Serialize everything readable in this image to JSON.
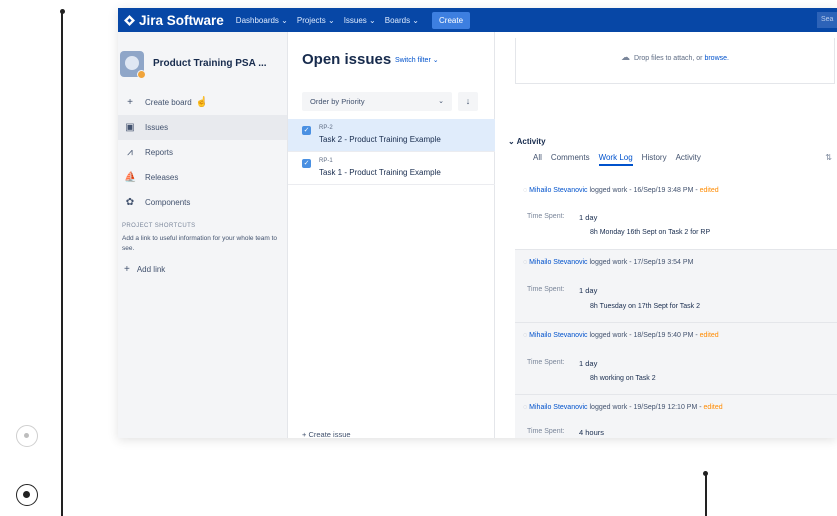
{
  "app": {
    "name": "Jira Software",
    "nav": [
      "Dashboards ⌄",
      "Projects ⌄",
      "Issues ⌄",
      "Boards ⌄"
    ],
    "create_label": "Create",
    "search_stub": "Sea"
  },
  "sidebar": {
    "project_name": "Product Training PSA ...",
    "create_board": "Create board",
    "items": [
      {
        "label": "Issues",
        "icon": "issues-icon"
      },
      {
        "label": "Reports",
        "icon": "reports-icon"
      },
      {
        "label": "Releases",
        "icon": "releases-icon"
      },
      {
        "label": "Components",
        "icon": "components-icon"
      }
    ],
    "shortcuts_title": "PROJECT SHORTCUTS",
    "shortcuts_note": "Add a link to useful information for your whole team to see.",
    "add_link": "Add link"
  },
  "issues_panel": {
    "title": "Open issues",
    "switch_filter": "Switch filter ⌄",
    "order_by": "Order by Priority",
    "issues": [
      {
        "key": "RP-2",
        "summary": "Task 2 - Product Training Example",
        "selected": true
      },
      {
        "key": "RP-1",
        "summary": "Task 1 - Product Training Example",
        "selected": false
      }
    ],
    "create_issue": "+ Create issue"
  },
  "detail": {
    "drop_text": "Drop files to attach, or",
    "drop_link": "browse.",
    "activity_title": "Activity",
    "tabs": [
      "All",
      "Comments",
      "Work Log",
      "History",
      "Activity"
    ],
    "active_tab": "Work Log",
    "time_spent_label": "Time Spent:",
    "worklogs": [
      {
        "user": "Mihailo Stevanovic",
        "action": "logged work - 16/Sep/19 3:48 PM -",
        "edited": "edited",
        "time": "1 day",
        "comment": "8h Monday 16th Sept on Task 2 for RP"
      },
      {
        "user": "Mihailo Stevanovic",
        "action": "logged work - 17/Sep/19 3:54 PM",
        "edited": "",
        "time": "1 day",
        "comment": "8h Tuesday on 17th Sept for Task 2"
      },
      {
        "user": "Mihailo Stevanovic",
        "action": "logged work - 18/Sep/19 5:40 PM -",
        "edited": "edited",
        "time": "1 day",
        "comment": "8h working on Task 2"
      },
      {
        "user": "Mihailo Stevanovic",
        "action": "logged work - 19/Sep/19 12:10 PM -",
        "edited": "edited",
        "time": "4 hours",
        "comment": ""
      }
    ]
  },
  "colors": {
    "topnav": "#0747a6",
    "link": "#0052cc",
    "edited": "#ff8b00",
    "selected_row": "#e0ecfb"
  }
}
